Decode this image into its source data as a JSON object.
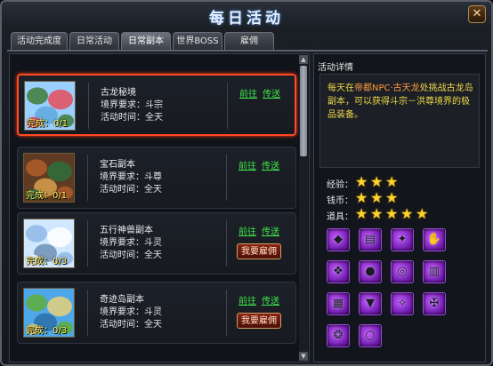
{
  "window": {
    "title": "每日活动",
    "close_label": "✕"
  },
  "tabs": [
    {
      "label": "活动完成度",
      "active": false
    },
    {
      "label": "日常活动",
      "active": false
    },
    {
      "label": "日常副本",
      "active": true
    },
    {
      "label": "世界BOSS",
      "active": false
    },
    {
      "label": "雇佣",
      "active": false
    }
  ],
  "dungeons": [
    {
      "name": "古龙秘境",
      "requirement": "境界要求：斗宗",
      "time": "活动时间：全天",
      "progress": "完成：0/1",
      "goto": "前往",
      "teleport": "传送",
      "hire": "",
      "selected": true,
      "palette": [
        "#9ad0ff",
        "#3f7b3a",
        "#e84c5b",
        "#5ea9de"
      ]
    },
    {
      "name": "宝石副本",
      "requirement": "境界要求：斗尊",
      "time": "活动时间：全天",
      "progress": "完成：0/1",
      "goto": "前往",
      "teleport": "传送",
      "hire": "",
      "selected": false,
      "palette": [
        "#5e3b22",
        "#b05d28",
        "#2e6f3b",
        "#d9a04c"
      ]
    },
    {
      "name": "五行神兽副本",
      "requirement": "境界要求：斗灵",
      "time": "活动时间：全天",
      "progress": "完成：0/3",
      "goto": "前往",
      "teleport": "传送",
      "hire": "我要雇佣",
      "selected": false,
      "palette": [
        "#cfe8ff",
        "#8fb7e6",
        "#ffffff",
        "#6f8fb5"
      ]
    },
    {
      "name": "奇迹岛副本",
      "requirement": "境界要求：斗灵",
      "time": "活动时间：全天",
      "progress": "完成：0/3",
      "goto": "前往",
      "teleport": "传送",
      "hire": "我要雇佣",
      "selected": false,
      "palette": [
        "#4da7e8",
        "#5fae3a",
        "#e8d07a",
        "#2d6fa8"
      ]
    }
  ],
  "detail": {
    "title": "活动详情",
    "desc_pre": "每天在",
    "desc_npc": "帝都NPC·古天龙",
    "desc_post": "处挑战古龙岛副本，可以获得斗宗－洪尊境界的极品装备。",
    "rewards": [
      {
        "label": "经验：",
        "stars": 3
      },
      {
        "label": "钱币：",
        "stars": 3
      },
      {
        "label": "道具：",
        "stars": 5
      }
    ],
    "items": [
      "wolf-mask-helmet-icon",
      "banded-armor-icon",
      "dragon-wings-icon",
      "clawed-gauntlet-icon",
      "winged-pauldron-icon",
      "dark-orb-icon",
      "purple-ring-icon",
      "spiked-belt-icon",
      "armored-belt-icon",
      "dragon-boots-icon",
      "bat-wings-icon",
      "beast-claw-icon",
      "gem-amulet-icon",
      "jade-ring-icon"
    ]
  },
  "colors": {
    "accent_green": "#3fe24a",
    "selection_border": "#ff4a22",
    "star": "#ffd22e",
    "item_bg": "#8a2ad0"
  }
}
